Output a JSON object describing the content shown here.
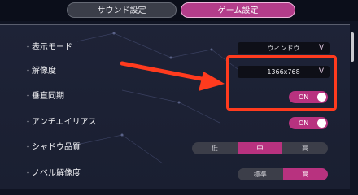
{
  "tabs": [
    {
      "label": "サウンド設定",
      "active": false
    },
    {
      "label": "ゲーム設定",
      "active": true
    }
  ],
  "settings": {
    "display_mode": {
      "label": "表示モード",
      "value": "ウィンドウ",
      "chevron": "V"
    },
    "resolution": {
      "label": "解像度",
      "value": "1366x768",
      "chevron": "V"
    },
    "vsync": {
      "label": "垂直同期",
      "state": "ON"
    },
    "antialias": {
      "label": "アンチエイリアス",
      "state": "ON"
    },
    "shadow_quality": {
      "label": "シャドウ品質",
      "options": [
        "低",
        "中",
        "高"
      ],
      "selected": "中"
    },
    "novel_resolution": {
      "label": "ノベル解像度",
      "options": [
        "標準",
        "高"
      ],
      "selected": "高"
    }
  },
  "colors": {
    "accent": "#b8327f",
    "annotation": "#ff3b1e",
    "background": "#1e2337"
  },
  "icons": [
    "arrow-annotation-icon",
    "knob-icon"
  ]
}
